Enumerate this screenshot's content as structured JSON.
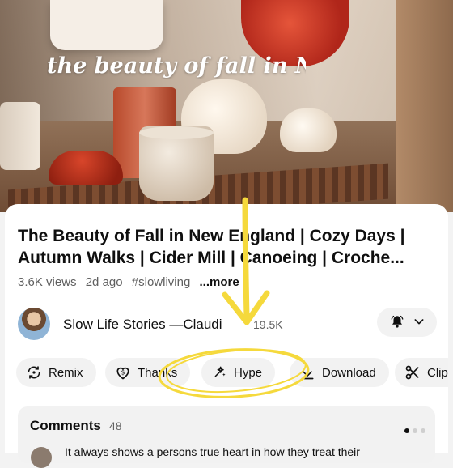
{
  "video": {
    "overlay_text": "the beauty of fall in New"
  },
  "video_title": {
    "line1": "The Beauty of Fall in New England | Cozy Days |",
    "line2": "Autumn Walks | Cider Mill | Canoeing | Croche..."
  },
  "meta": {
    "views": "3.6K views",
    "age": "2d ago",
    "hashtag": "#slowliving",
    "more": "...more"
  },
  "channel": {
    "name": "Slow Life Stories —Claudi",
    "subscribers": "19.5K",
    "bell_icon": "bell-icon",
    "chevron_icon": "chevron-down-icon"
  },
  "actions": [
    {
      "label": "Remix",
      "icon": "remix-icon"
    },
    {
      "label": "Thanks",
      "icon": "thanks-icon"
    },
    {
      "label": "Hype",
      "icon": "hype-icon"
    },
    {
      "label": "Download",
      "icon": "download-icon"
    },
    {
      "label": "Clip",
      "icon": "clip-icon"
    }
  ],
  "comments": {
    "title": "Comments",
    "count": "48",
    "preview": "It always shows a persons true heart in how they treat their"
  },
  "colors": {
    "annotation": "#f5d93c",
    "chip_bg": "#f2f2f2",
    "text": "#0f0f0f"
  }
}
